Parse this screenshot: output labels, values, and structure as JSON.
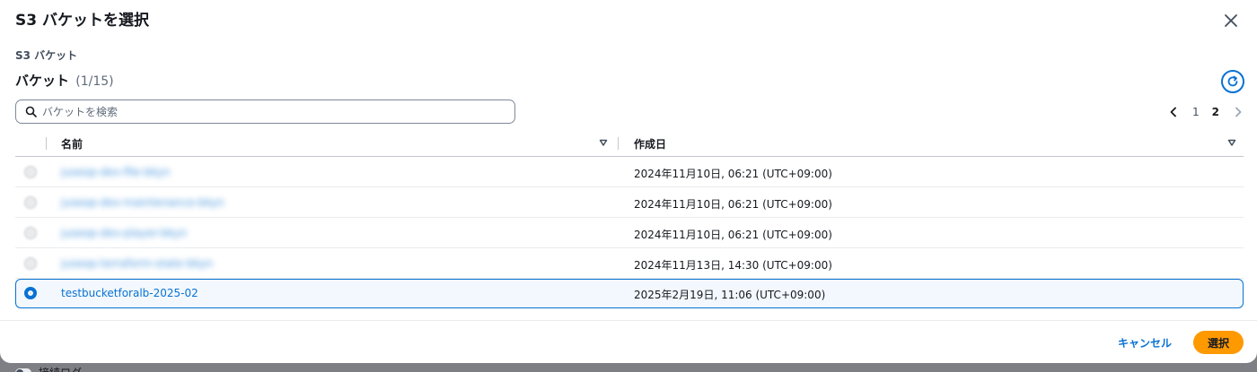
{
  "modal": {
    "title": "S3 バケットを選択",
    "section_label": "S3 バケット",
    "bucket_heading": "バケット",
    "bucket_count": "(1/15)"
  },
  "search": {
    "placeholder": "バケットを検索",
    "value": ""
  },
  "pagination": {
    "pages": [
      "1",
      "2"
    ],
    "current_page": "2"
  },
  "table": {
    "columns": [
      "名前",
      "作成日"
    ],
    "rows": [
      {
        "name": "juseop-dev-file-bkyn",
        "date": "2024年11月10日, 06:21 (UTC+09:00)",
        "selected": false
      },
      {
        "name": "juseop-dev-maintenance-bkyn",
        "date": "2024年11月10日, 06:21 (UTC+09:00)",
        "selected": false
      },
      {
        "name": "juseop-dev-player-bkyn",
        "date": "2024年11月10日, 06:21 (UTC+09:00)",
        "selected": false
      },
      {
        "name": "juseop-terraform-state-bkyn",
        "date": "2024年11月13日, 14:30 (UTC+09:00)",
        "selected": false
      },
      {
        "name": "testbucketforalb-2025-02",
        "date": "2025年2月19日, 11:06 (UTC+09:00)",
        "selected": true
      }
    ]
  },
  "footer": {
    "cancel_label": "キャンセル",
    "select_label": "選択"
  },
  "background": {
    "toggle_label": "接続ログ"
  },
  "colors": {
    "accent": "#0972d3",
    "primary_button": "#ff9900",
    "selected_row_bg": "#f2f8fd"
  },
  "icons": {
    "close": "close-icon",
    "refresh": "refresh-icon",
    "search": "search-icon",
    "prev": "chevron-left-icon",
    "next": "chevron-right-icon",
    "sort": "sort-caret-down-icon"
  }
}
